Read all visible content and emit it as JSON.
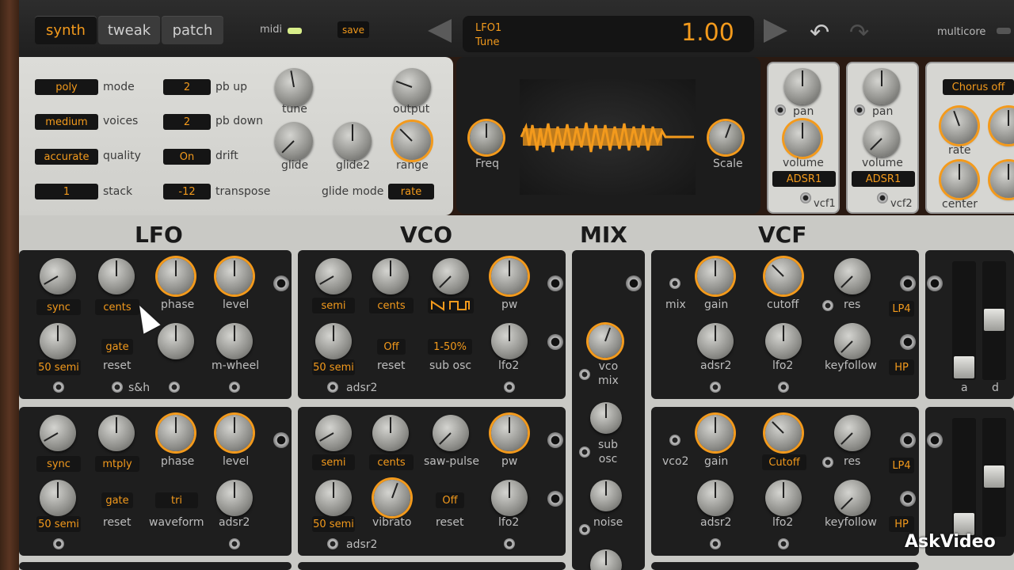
{
  "topbar": {
    "tabs": [
      {
        "label": "synth",
        "active": true
      },
      {
        "label": "tweak",
        "active": false
      },
      {
        "label": "patch",
        "active": false
      }
    ],
    "midi_label": "midi",
    "save_label": "save",
    "display_param_line1": "LFO1",
    "display_param_line2": "Tune",
    "display_value": "1.00",
    "multicore_label": "multicore"
  },
  "global": {
    "mode": {
      "value": "poly",
      "label": "mode"
    },
    "voices": {
      "value": "medium",
      "label": "voices"
    },
    "quality": {
      "value": "accurate",
      "label": "quality"
    },
    "stack": {
      "value": "1",
      "label": "stack"
    },
    "pb_up": {
      "value": "2",
      "label": "pb up"
    },
    "pb_down": {
      "value": "2",
      "label": "pb down"
    },
    "drift": {
      "value": "On",
      "label": "drift"
    },
    "transpose": {
      "value": "-12",
      "label": "transpose"
    },
    "knob_tune": "tune",
    "knob_output": "output",
    "knob_glide": "glide",
    "knob_glide2": "glide2",
    "knob_range": "range",
    "glide_mode_label": "glide mode",
    "glide_mode_value": "rate"
  },
  "scope": {
    "freq_label": "Freq",
    "scale_label": "Scale"
  },
  "vcf_mods": [
    {
      "pan": "pan",
      "volume": "volume",
      "env": "ADSR1",
      "out": "vcf1"
    },
    {
      "pan": "pan",
      "volume": "volume",
      "env": "ADSR1",
      "out": "vcf2"
    }
  ],
  "chorus": {
    "button": "Chorus off",
    "rate": "rate",
    "center": "center"
  },
  "sections": {
    "lfo": "LFO",
    "vco": "VCO",
    "mix": "MIX",
    "vcf": "VCF"
  },
  "lfo1": {
    "sync": "sync",
    "cents": "cents",
    "phase": "phase",
    "level": "level",
    "semi": "50 semi",
    "gate": "gate",
    "reset": "reset",
    "mwheel": "m-wheel",
    "sh": "s&h"
  },
  "lfo2": {
    "sync": "sync",
    "mtply": "mtply",
    "phase": "phase",
    "level": "level",
    "semi": "50 semi",
    "gate": "gate",
    "reset": "reset",
    "tri": "tri",
    "waveform": "waveform",
    "adsr2": "adsr2"
  },
  "vco1": {
    "semi": "semi",
    "cents": "cents",
    "pw": "pw",
    "semi_val": "50 semi",
    "off": "Off",
    "reset": "reset",
    "subosc_val": "1-50%",
    "subosc": "sub osc",
    "lfo2": "lfo2",
    "adsr2": "adsr2"
  },
  "vco2": {
    "semi": "semi",
    "cents": "cents",
    "sawpulse": "saw-pulse",
    "pw": "pw",
    "semi_val": "50 semi",
    "vibrato": "vibrato",
    "off": "Off",
    "reset": "reset",
    "lfo2": "lfo2",
    "adsr2": "adsr2"
  },
  "mix": {
    "vco_mix_1": "vco",
    "vco_mix_2": "mix",
    "sub_1": "sub",
    "sub_2": "osc",
    "noise": "noise"
  },
  "vcf1": {
    "mix": "mix",
    "gain": "gain",
    "cutoff": "cutoff",
    "res": "res",
    "lp4": "LP4",
    "adsr2": "adsr2",
    "lfo2": "lfo2",
    "keyfollow": "keyfollow",
    "hp": "HP"
  },
  "vcf2": {
    "vco2": "vco2",
    "gain": "gain",
    "cutoff": "Cutoff",
    "res": "res",
    "lp4": "LP4",
    "adsr2": "adsr2",
    "lfo2": "lfo2",
    "keyfollow": "keyfollow",
    "hp": "HP"
  },
  "adsr": {
    "a": "a",
    "d": "d"
  },
  "watermark": "AskVideo"
}
